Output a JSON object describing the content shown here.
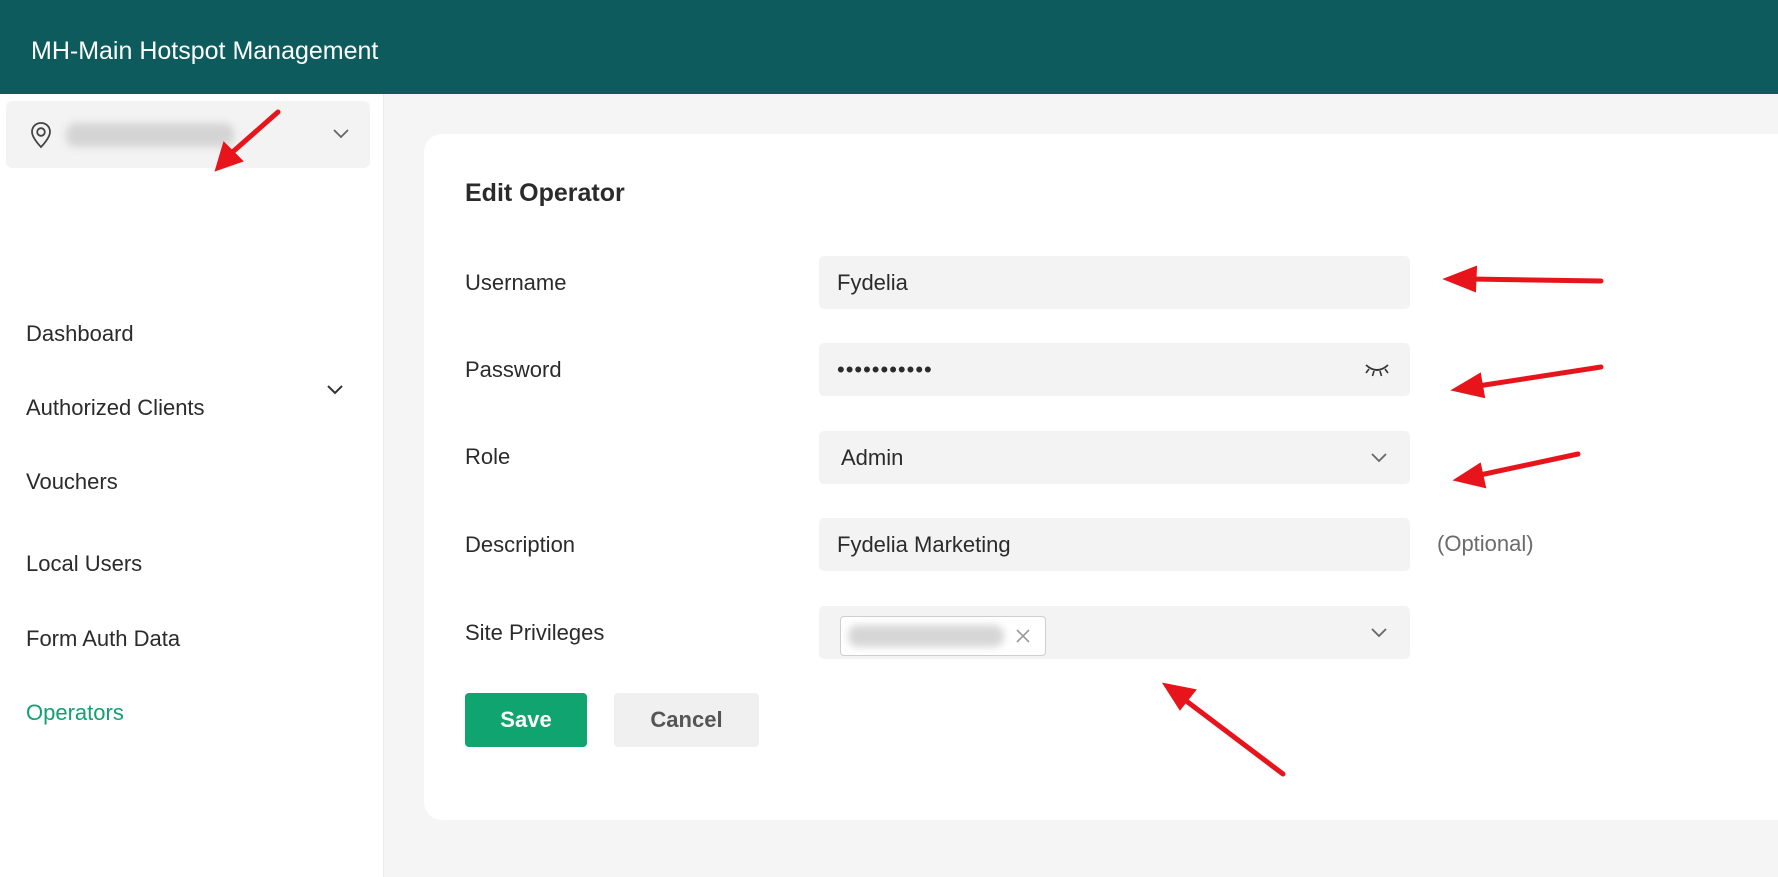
{
  "header": {
    "title": "MH-Main Hotspot Management"
  },
  "sidebar": {
    "site_selector": {
      "icon": "location-pin-icon"
    },
    "items": [
      {
        "label": "Dashboard"
      },
      {
        "label": "Authorized Clients"
      },
      {
        "label": "Vouchers",
        "expandable": true
      },
      {
        "label": "Local Users"
      },
      {
        "label": "Form Auth Data"
      },
      {
        "label": "Operators",
        "active": true
      }
    ]
  },
  "form": {
    "title": "Edit Operator",
    "username": {
      "label": "Username",
      "value": "Fydelia"
    },
    "password": {
      "label": "Password",
      "value": "•••••••••••",
      "icon": "eye-closed-icon"
    },
    "role": {
      "label": "Role",
      "value": "Admin"
    },
    "description": {
      "label": "Description",
      "value": "Fydelia Marketing",
      "hint": "(Optional)"
    },
    "site_privileges": {
      "label": "Site Privileges"
    },
    "save_label": "Save",
    "cancel_label": "Cancel"
  },
  "colors": {
    "header_bg": "#0d5b5c",
    "accent": "#10a570",
    "active_nav": "#12a06f",
    "annotation_arrow": "#e8141b"
  }
}
